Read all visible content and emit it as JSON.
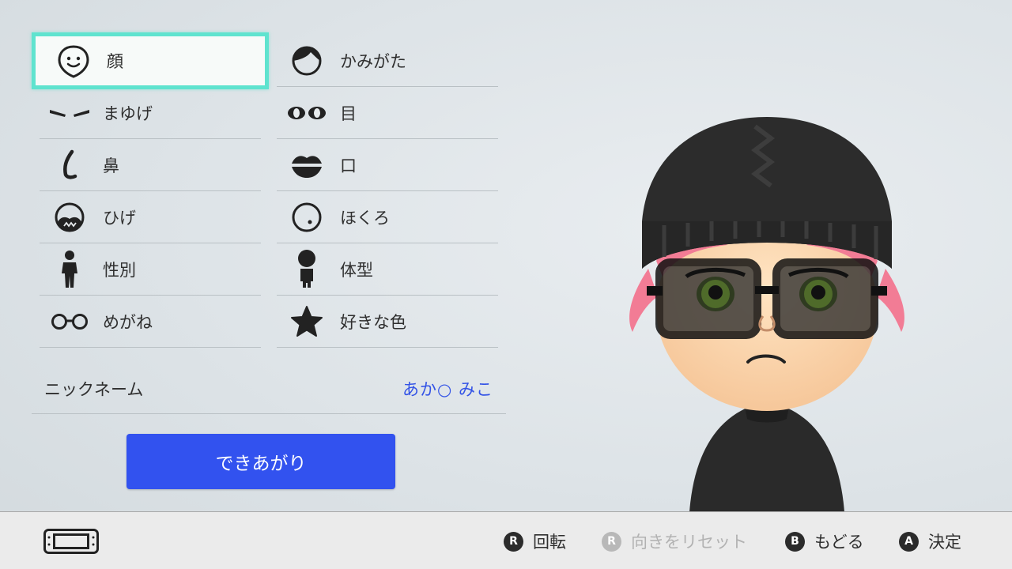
{
  "menu": {
    "items": [
      {
        "label": "顔",
        "icon": "face-shape-icon",
        "selected": true
      },
      {
        "label": "かみがた",
        "icon": "hairstyle-icon"
      },
      {
        "label": "まゆげ",
        "icon": "eyebrows-icon"
      },
      {
        "label": "目",
        "icon": "eyes-icon"
      },
      {
        "label": "鼻",
        "icon": "nose-icon"
      },
      {
        "label": "口",
        "icon": "mouth-icon"
      },
      {
        "label": "ひげ",
        "icon": "beard-icon"
      },
      {
        "label": "ほくろ",
        "icon": "mole-icon"
      },
      {
        "label": "性別",
        "icon": "gender-icon"
      },
      {
        "label": "体型",
        "icon": "body-type-icon"
      },
      {
        "label": "めがね",
        "icon": "glasses-icon"
      },
      {
        "label": "好きな色",
        "icon": "favorite-color-star-icon"
      }
    ]
  },
  "nickname": {
    "label": "ニックネーム",
    "value": "あか○ みこ"
  },
  "done_button": "できあがり",
  "footer": {
    "rotate": "回転",
    "reset_direction": "向きをリセット",
    "back": "もどる",
    "confirm": "決定",
    "r_glyph": "R",
    "b_glyph": "B",
    "a_glyph": "A"
  },
  "colors": {
    "accent_blue": "#3252ef",
    "selection_teal": "#5fe3cf",
    "nickname_blue": "#3353e6",
    "hair_pink": "#f27c95"
  }
}
